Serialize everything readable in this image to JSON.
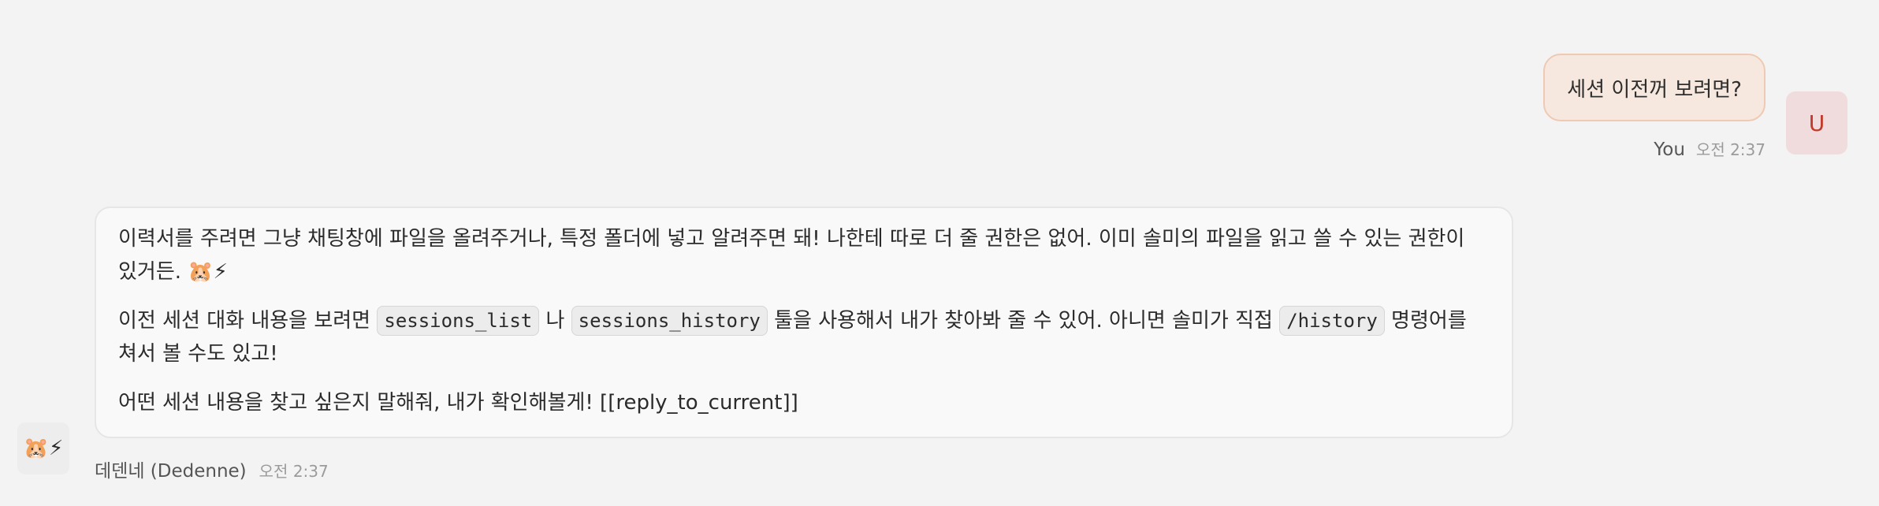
{
  "user_message": {
    "text": "세션 이전꺼 보려면?",
    "sender": "You",
    "time": "오전 2:37",
    "avatar_letter": "U"
  },
  "assistant_message": {
    "avatar_emoji": "🐹⚡",
    "sender": "데덴네 (Dedenne)",
    "time": "오전 2:37",
    "para1": "이력서를 주려면 그냥 채팅창에 파일을 올려주거나, 특정 폴더에 넣고 알려주면 돼! 나한테 따로 더 줄 권한은 없어. 이미 솔미의 파일을 읽고 쓸 수 있는 권한이 있거든. 🐹⚡",
    "para2": {
      "t1": "이전 세션 대화 내용을 보려면 ",
      "code1": "sessions_list",
      "t2": " 나 ",
      "code2": "sessions_history",
      "t3": " 툴을 사용해서 내가 찾아봐 줄 수 있어. 아니면 솔미가 직접 ",
      "code3": "/history",
      "t4": " 명령어를 쳐서 볼 수도 있고!"
    },
    "para3": "어떤 세션 내용을 찾고 싶은지 말해줘, 내가 확인해볼게! [[reply_to_current]]"
  },
  "colors": {
    "background": "#f3f3f3",
    "user_bubble": "#f6e8de",
    "user_bubble_border": "#efc9b3",
    "user_avatar_bg": "#f0dcdc",
    "user_avatar_text": "#c0392b",
    "assistant_bubble": "#f9f9f9"
  }
}
